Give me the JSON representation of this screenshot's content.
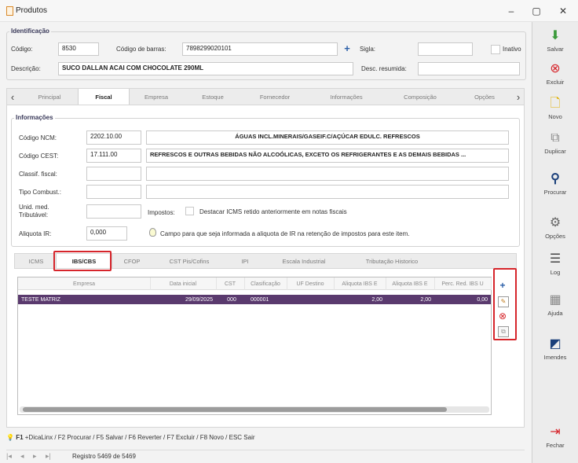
{
  "window": {
    "title": "Produtos",
    "minimize": "–",
    "maximize": "▢",
    "close": "✕"
  },
  "ident": {
    "section": "Identificação",
    "codigo_label": "Código:",
    "codigo": "8530",
    "barcode_label": "Código de barras:",
    "barcode": "7898299020101",
    "sigla_label": "Sigla:",
    "sigla": "",
    "inativo_label": "Inativo",
    "descricao_label": "Descrição:",
    "descricao": "SUCO DALLAN ACAI COM CHOCOLATE 290ML",
    "desc_resumida_label": "Desc. resumida:",
    "desc_resumida": ""
  },
  "main_tabs": [
    "Principal",
    "Fiscal",
    "Empresa",
    "Estoque",
    "Fornecedor",
    "Informações",
    "Composição",
    "Opções"
  ],
  "info": {
    "section": "Informações",
    "ncm_label": "Código NCM:",
    "ncm": "2202.10.00",
    "ncm_desc": "ÁGUAS INCL.MINERAIS/GASEIF.C/AÇÚCAR EDULC. REFRESCOS",
    "cest_label": "Código CEST:",
    "cest": "17.111.00",
    "cest_desc": "REFRESCOS E OUTRAS BEBIDAS NÃO ALCOÓLICAS, EXCETO OS REFRIGERANTES E AS DEMAIS BEBIDAS ...",
    "classif_label": "Classif. fiscal:",
    "combust_label": "Tipo Combust.:",
    "unid_label1": "Unid. med.",
    "unid_label2": "Tributável:",
    "impostos_label": "Impostos:",
    "destacar_label": "Destacar ICMS retido anteriormente em notas fiscais",
    "aliq_label": "Aliquota IR:",
    "aliq": "0,000",
    "aliq_hint": "Campo para que seja informada a aliquota de IR na retenção de impostos para este item."
  },
  "sub_tabs": [
    "ICMS",
    "IBS/CBS",
    "CFOP",
    "CST Pis/Cofins",
    "IPI",
    "Escala Industrial",
    "Tributação Historico"
  ],
  "grid": {
    "headers": [
      "Empresa",
      "Data inicial",
      "CST",
      "Clasificação",
      "UF Destino",
      "Aliquota IBS E",
      "Aliquota IBS E",
      "Perc. Red. IBS U"
    ],
    "row": [
      "TESTE MATRIZ",
      "29/09/2025",
      "000",
      "000001",
      "",
      "2,00",
      "2,00",
      "0,00"
    ]
  },
  "toolbar": [
    "Salvar",
    "Excluir",
    "Novo",
    "Duplicar",
    "Procurar",
    "Opções",
    "Log",
    "Ajuda",
    "Imendes",
    "Fechar"
  ],
  "footer": {
    "hint_prefix": "F1",
    "hint": " +DicaLinx / F2 Procurar / F5 Salvar / F6 Reverter / F7 Excluir / F8 Novo / ESC Sair",
    "record": "Registro 5469 de 5469"
  },
  "colors": {
    "accent": "#5a3a6e",
    "highlight": "#d6252b"
  }
}
